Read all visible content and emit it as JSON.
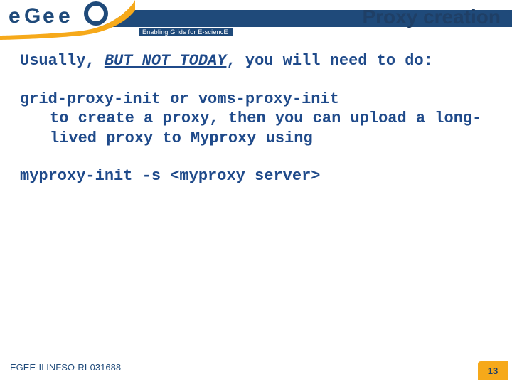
{
  "header": {
    "title": "Proxy creation",
    "tagline": "Enabling Grids for E-sciencE",
    "logo_alt": "egee"
  },
  "body": {
    "line1_a": "Usually, ",
    "line1_em": "BUT NOT TODAY",
    "line1_b": ", you will need to do:",
    "line2": "grid-proxy-init or voms-proxy-init",
    "line3": "to create a proxy, then you can upload a long-lived proxy to Myproxy using",
    "line4": "myproxy-init -s <myproxy server>"
  },
  "footer": {
    "left": "EGEE-II INFSO-RI-031688",
    "page": "13"
  }
}
